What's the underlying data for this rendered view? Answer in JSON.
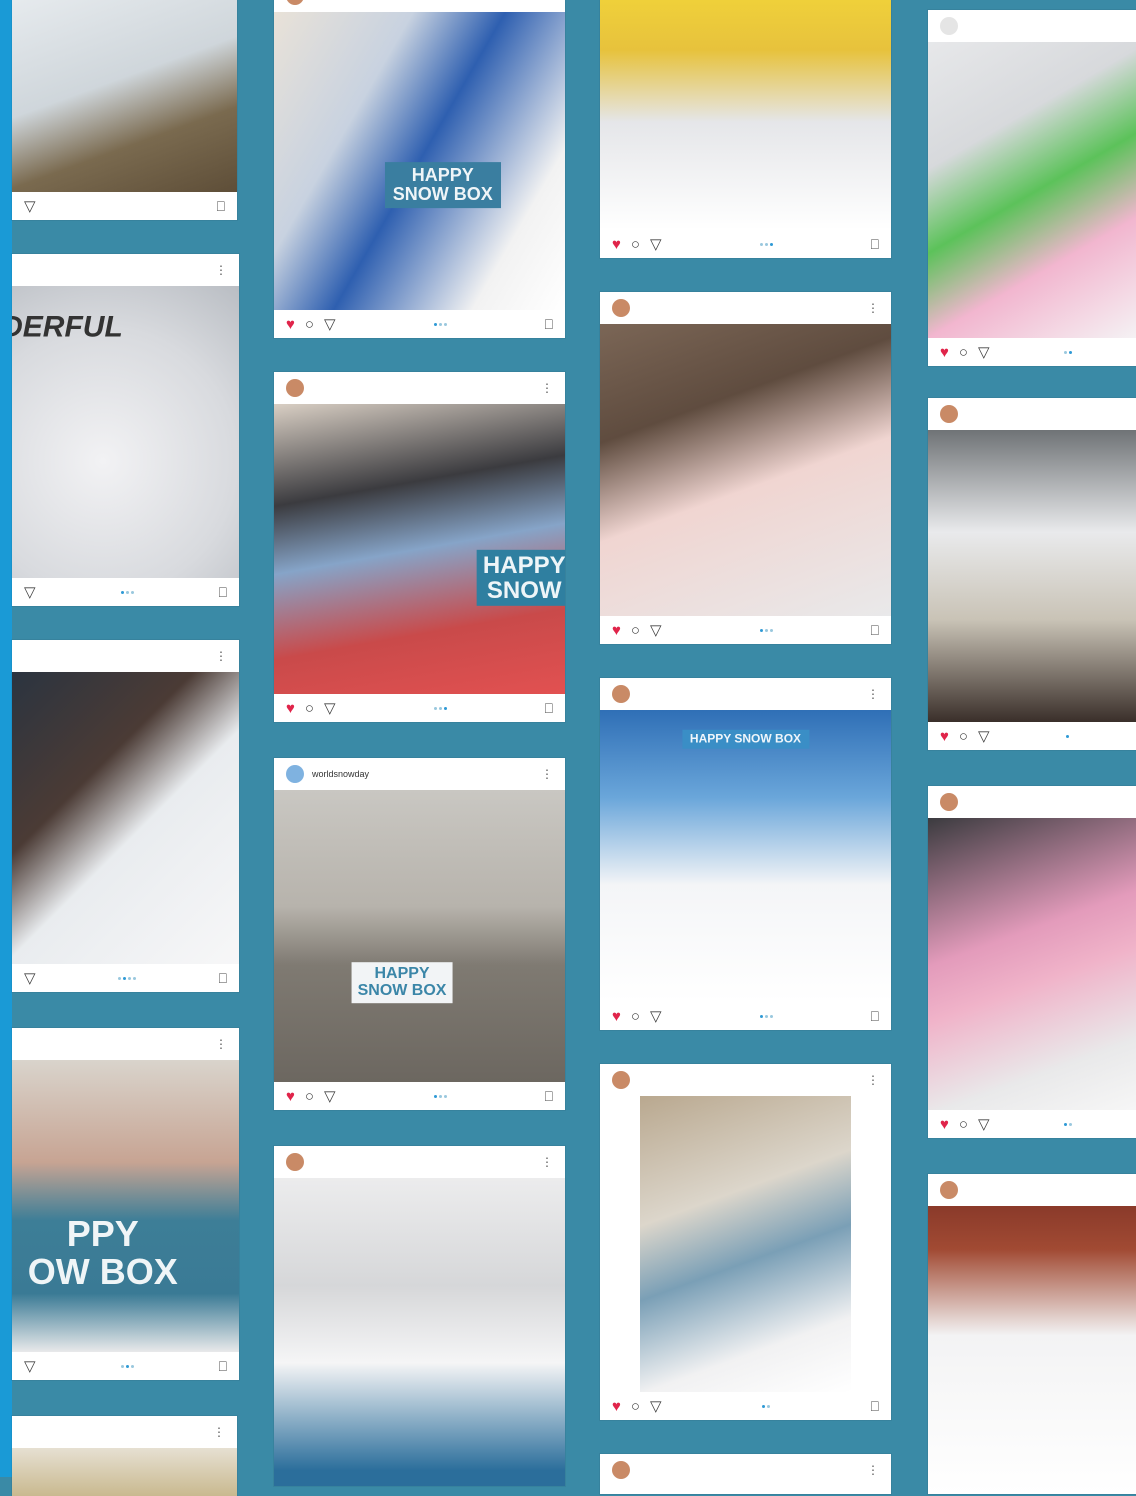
{
  "colors": {
    "background": "#3a8aa6",
    "strip": "#1a9ad6",
    "heart": "#e0244a"
  },
  "icons": [
    "heart-icon",
    "comment-icon",
    "share-icon",
    "bookmark-icon",
    "more-icon"
  ],
  "posts": {
    "c1p1": {
      "user": ""
    },
    "c1p2": {
      "user": ""
    },
    "c1p3": {
      "user": ""
    },
    "c1p4": {
      "user": ""
    },
    "c1p5": {
      "user": ""
    },
    "c2p1": {
      "user": ""
    },
    "c2p2": {
      "user": ""
    },
    "c2p3": {
      "user": "worldsnowday"
    },
    "c2p4": {
      "user": ""
    },
    "c3p1": {
      "user": ""
    },
    "c3p2": {
      "user": ""
    },
    "c3p3": {
      "user": ""
    },
    "c3p4": {
      "user": ""
    },
    "c3p5": {
      "user": ""
    },
    "c4p1": {
      "user": ""
    },
    "c4p2": {
      "user": ""
    },
    "c4p3": {
      "user": ""
    },
    "c4p4": {
      "user": ""
    }
  },
  "photo_text": {
    "c1p2": "DERFUL",
    "c1p4": "PPY\nOW BOX",
    "c2p1": "HAPPY\nSNOW BOX",
    "c2p2": "HAPPY\nSNOW",
    "c2p3": "HAPPY\nSNOW BOX",
    "c3p3": "HAPPY SNOW BOX"
  }
}
